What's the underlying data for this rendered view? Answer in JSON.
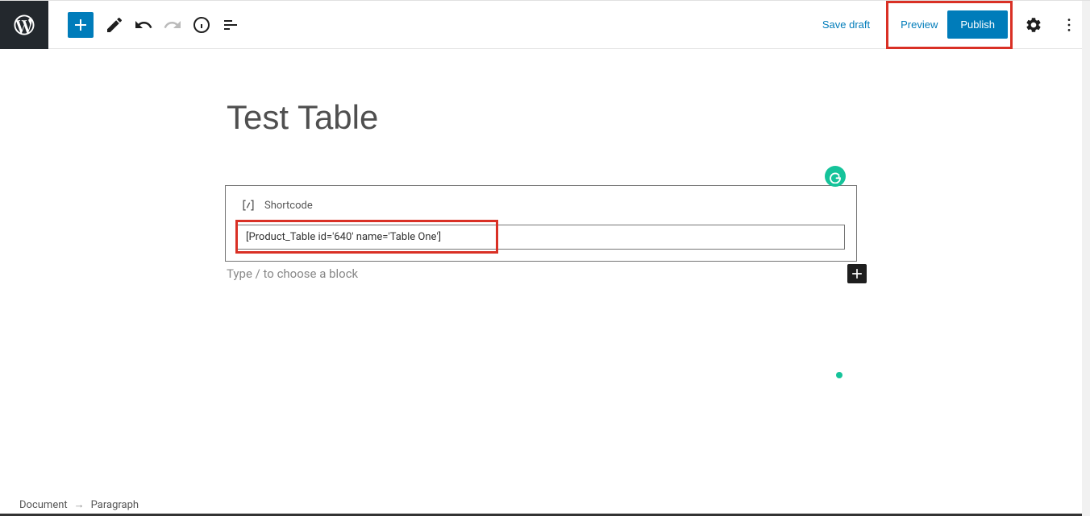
{
  "toolbar": {
    "save_draft": "Save draft",
    "preview": "Preview",
    "publish": "Publish"
  },
  "editor": {
    "title": "Test Table",
    "shortcode_label": "Shortcode",
    "shortcode_value": "[Product_Table id='640' name='Table One']",
    "appender_placeholder": "Type / to choose a block"
  },
  "breadcrumb": {
    "root": "Document",
    "current": "Paragraph"
  },
  "grammarly_letter": "G"
}
